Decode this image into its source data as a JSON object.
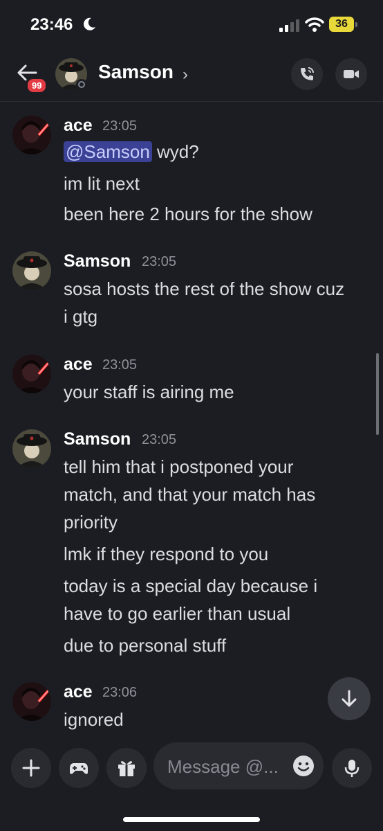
{
  "status_bar": {
    "time": "23:46",
    "battery": "36"
  },
  "header": {
    "title": "Samson",
    "notification_count": "99"
  },
  "messages": [
    {
      "author": "ace",
      "time": "23:05",
      "lines": [
        "wyd?",
        "im lit next",
        "been here 2 hours for the show"
      ],
      "mention": "@Samson"
    },
    {
      "author": "Samson",
      "time": "23:05",
      "lines": [
        "sosa hosts the rest of the show cuz",
        "i gtg"
      ]
    },
    {
      "author": "ace",
      "time": "23:05",
      "lines": [
        "your staff is airing me"
      ]
    },
    {
      "author": "Samson",
      "time": "23:05",
      "lines": [
        "tell him that i postponed your",
        "match, and that your match has",
        "priority",
        "lmk if they respond to you",
        "today is a special day because i",
        "have to go earlier than usual",
        "due to personal stuff"
      ]
    },
    {
      "author": "ace",
      "time": "23:06",
      "lines": [
        "ignored"
      ]
    }
  ],
  "composer": {
    "placeholder": "Message @..."
  },
  "icons": {
    "back": "arrow-left-icon",
    "call": "phone-call-icon",
    "video": "video-camera-icon",
    "plus": "plus-icon",
    "games": "gamepad-icon",
    "gift": "gift-icon",
    "emoji": "smiley-icon",
    "mic": "microphone-icon",
    "jump": "arrow-down-icon"
  },
  "colors": {
    "background": "#1c1d22",
    "mention_bg": "#3b4296",
    "badge": "#e23b43",
    "battery": "#e8d83a"
  }
}
